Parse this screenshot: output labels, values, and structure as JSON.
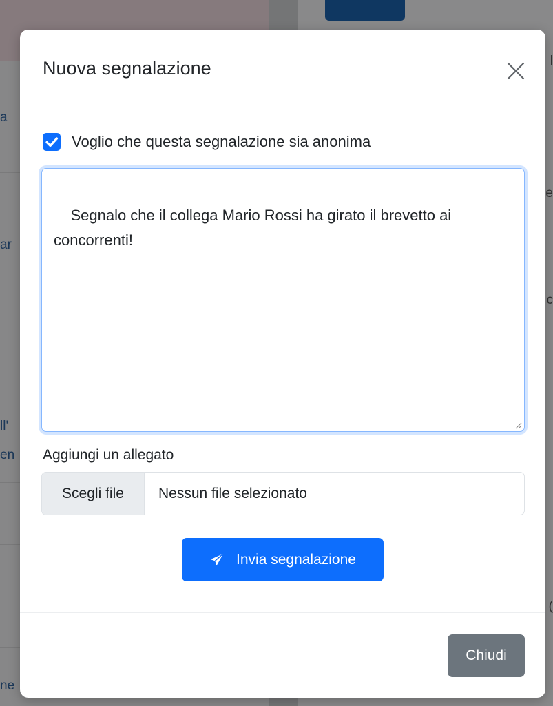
{
  "background": {
    "left_links": [
      "a",
      "ar",
      "ll'",
      "en",
      "ne"
    ],
    "right_fragments": [
      "l",
      "e",
      "c",
      "("
    ]
  },
  "modal": {
    "title": "Nuova segnalazione",
    "close_icon": "close-icon",
    "anonymous_checkbox": {
      "checked": true,
      "label": "Voglio che questa segnalazione sia anonima"
    },
    "message": "Segnalo che il collega Mario Rossi ha girato il brevetto ai concorrenti!",
    "attachment": {
      "label": "Aggiungi un allegato",
      "choose_label": "Scegli file",
      "status": "Nessun file selezionato"
    },
    "send_button": {
      "icon": "paper-plane-icon",
      "label": "Invia segnalazione"
    },
    "close_button": "Chiudi"
  },
  "colors": {
    "primary": "#0d6efd",
    "secondary": "#6c757d",
    "focus_border": "#86b7fe"
  }
}
